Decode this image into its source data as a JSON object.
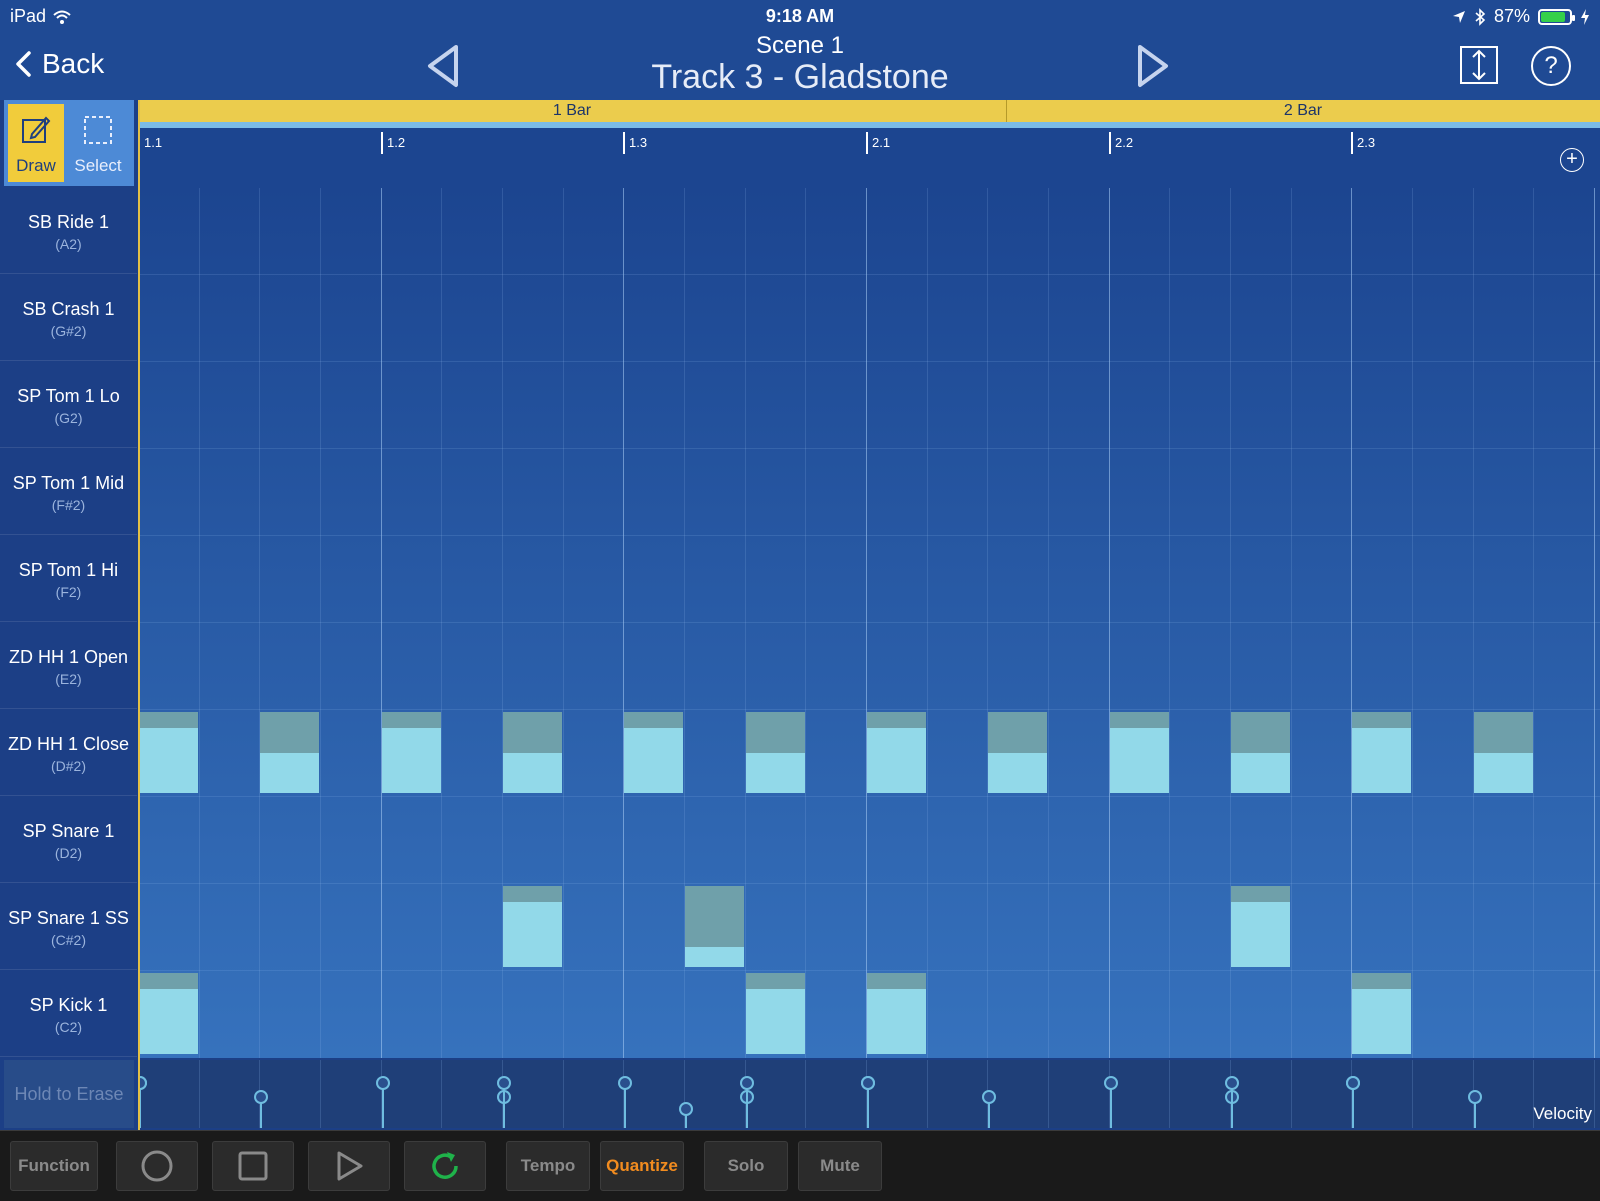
{
  "status_bar": {
    "device": "iPad",
    "time": "9:18 AM",
    "battery": "87%",
    "battery_level": 0.87,
    "icons": [
      "wifi-icon",
      "location-icon",
      "bluetooth-icon",
      "battery-icon",
      "charging-icon"
    ]
  },
  "header": {
    "back_label": "Back",
    "scene": "Scene  1",
    "track": "Track 3 - Gladstone",
    "help_glyph": "?"
  },
  "tools": {
    "draw_label": "Draw",
    "select_label": "Select",
    "active": "draw"
  },
  "ruler": {
    "bars": [
      "1 Bar",
      "2 Bar"
    ],
    "ticks": [
      "1.1",
      "1.2",
      "1.3",
      "2.1",
      "2.2",
      "2.3"
    ],
    "add_glyph": "+"
  },
  "instruments": [
    {
      "name": "SB Ride 1",
      "note": "(A2)"
    },
    {
      "name": "SB Crash 1",
      "note": "(G#2)"
    },
    {
      "name": "SP Tom 1 Lo",
      "note": "(G2)"
    },
    {
      "name": "SP Tom 1 Mid",
      "note": "(F#2)"
    },
    {
      "name": "SP Tom 1 Hi",
      "note": "(F2)"
    },
    {
      "name": "ZD HH 1 Open",
      "note": "(E2)"
    },
    {
      "name": "ZD HH 1 Close",
      "note": "(D#2)"
    },
    {
      "name": "SP Snare 1",
      "note": "(D2)"
    },
    {
      "name": "SP Snare 1 SS",
      "note": "(C#2)"
    },
    {
      "name": "SP Kick 1",
      "note": "(C2)"
    }
  ],
  "grid": {
    "steps": 24,
    "steps_per_beat": 4,
    "notes": [
      {
        "row": 6,
        "step": 0,
        "velocity": 0.8
      },
      {
        "row": 6,
        "step": 2,
        "velocity": 0.5
      },
      {
        "row": 6,
        "step": 4,
        "velocity": 0.8
      },
      {
        "row": 6,
        "step": 6,
        "velocity": 0.5
      },
      {
        "row": 6,
        "step": 8,
        "velocity": 0.8
      },
      {
        "row": 6,
        "step": 10,
        "velocity": 0.5
      },
      {
        "row": 6,
        "step": 12,
        "velocity": 0.8
      },
      {
        "row": 6,
        "step": 14,
        "velocity": 0.5
      },
      {
        "row": 6,
        "step": 16,
        "velocity": 0.8
      },
      {
        "row": 6,
        "step": 18,
        "velocity": 0.5
      },
      {
        "row": 6,
        "step": 20,
        "velocity": 0.8
      },
      {
        "row": 6,
        "step": 22,
        "velocity": 0.5
      },
      {
        "row": 8,
        "step": 6,
        "velocity": 0.8
      },
      {
        "row": 8,
        "step": 9,
        "velocity": 0.25
      },
      {
        "row": 8,
        "step": 18,
        "velocity": 0.8
      },
      {
        "row": 9,
        "step": 0,
        "velocity": 0.8
      },
      {
        "row": 9,
        "step": 10,
        "velocity": 0.8
      },
      {
        "row": 9,
        "step": 12,
        "velocity": 0.8
      },
      {
        "row": 9,
        "step": 20,
        "velocity": 0.8
      }
    ]
  },
  "velocity_lane": {
    "erase_label": "Hold to Erase",
    "label": "Velocity"
  },
  "transport": {
    "function_label": "Function",
    "tempo_label": "Tempo",
    "quantize_label": "Quantize",
    "solo_label": "Solo",
    "mute_label": "Mute",
    "active_color": "#f28c1f",
    "loop_color": "#1fb24a"
  }
}
